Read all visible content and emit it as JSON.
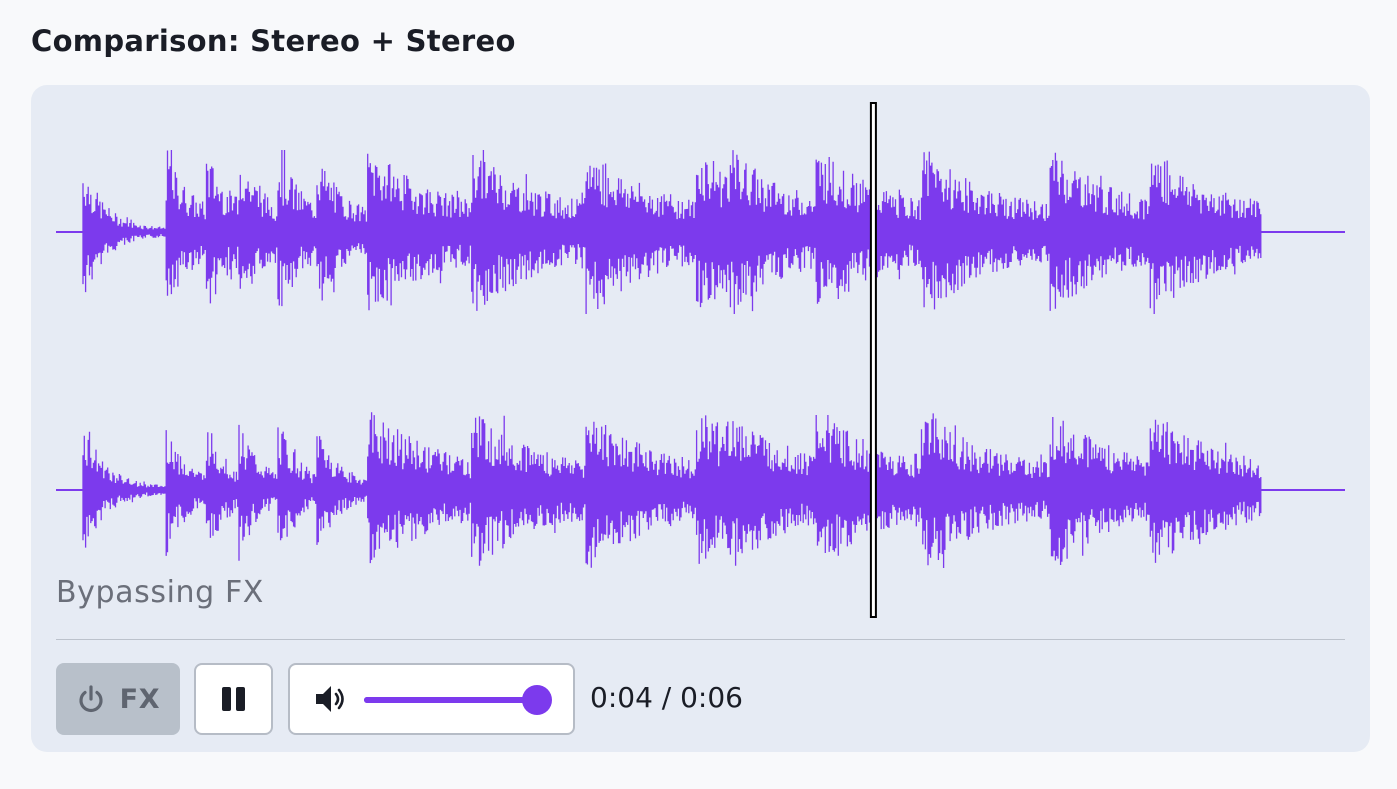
{
  "page_title": "Comparison: Stereo + Stereo",
  "player": {
    "status_text": "Bypassing FX",
    "fx_button_label": "FX",
    "time_display": "0:04 / 0:06",
    "current_time": "0:04",
    "duration": "0:06",
    "playhead_fraction": 0.67,
    "volume_fraction": 1.0,
    "playing": true,
    "fx_bypassed": true
  },
  "waveform": {
    "channels": [
      "left",
      "right"
    ],
    "color": "#7c3aed"
  },
  "icons": {
    "fx_button": "power-icon",
    "pause_button": "pause-icon",
    "volume": "speaker-icon"
  },
  "colors": {
    "accent": "#7c3aed",
    "card_background": "#e6ebf4",
    "fx_button_bypassed": "#b8c0ca"
  }
}
